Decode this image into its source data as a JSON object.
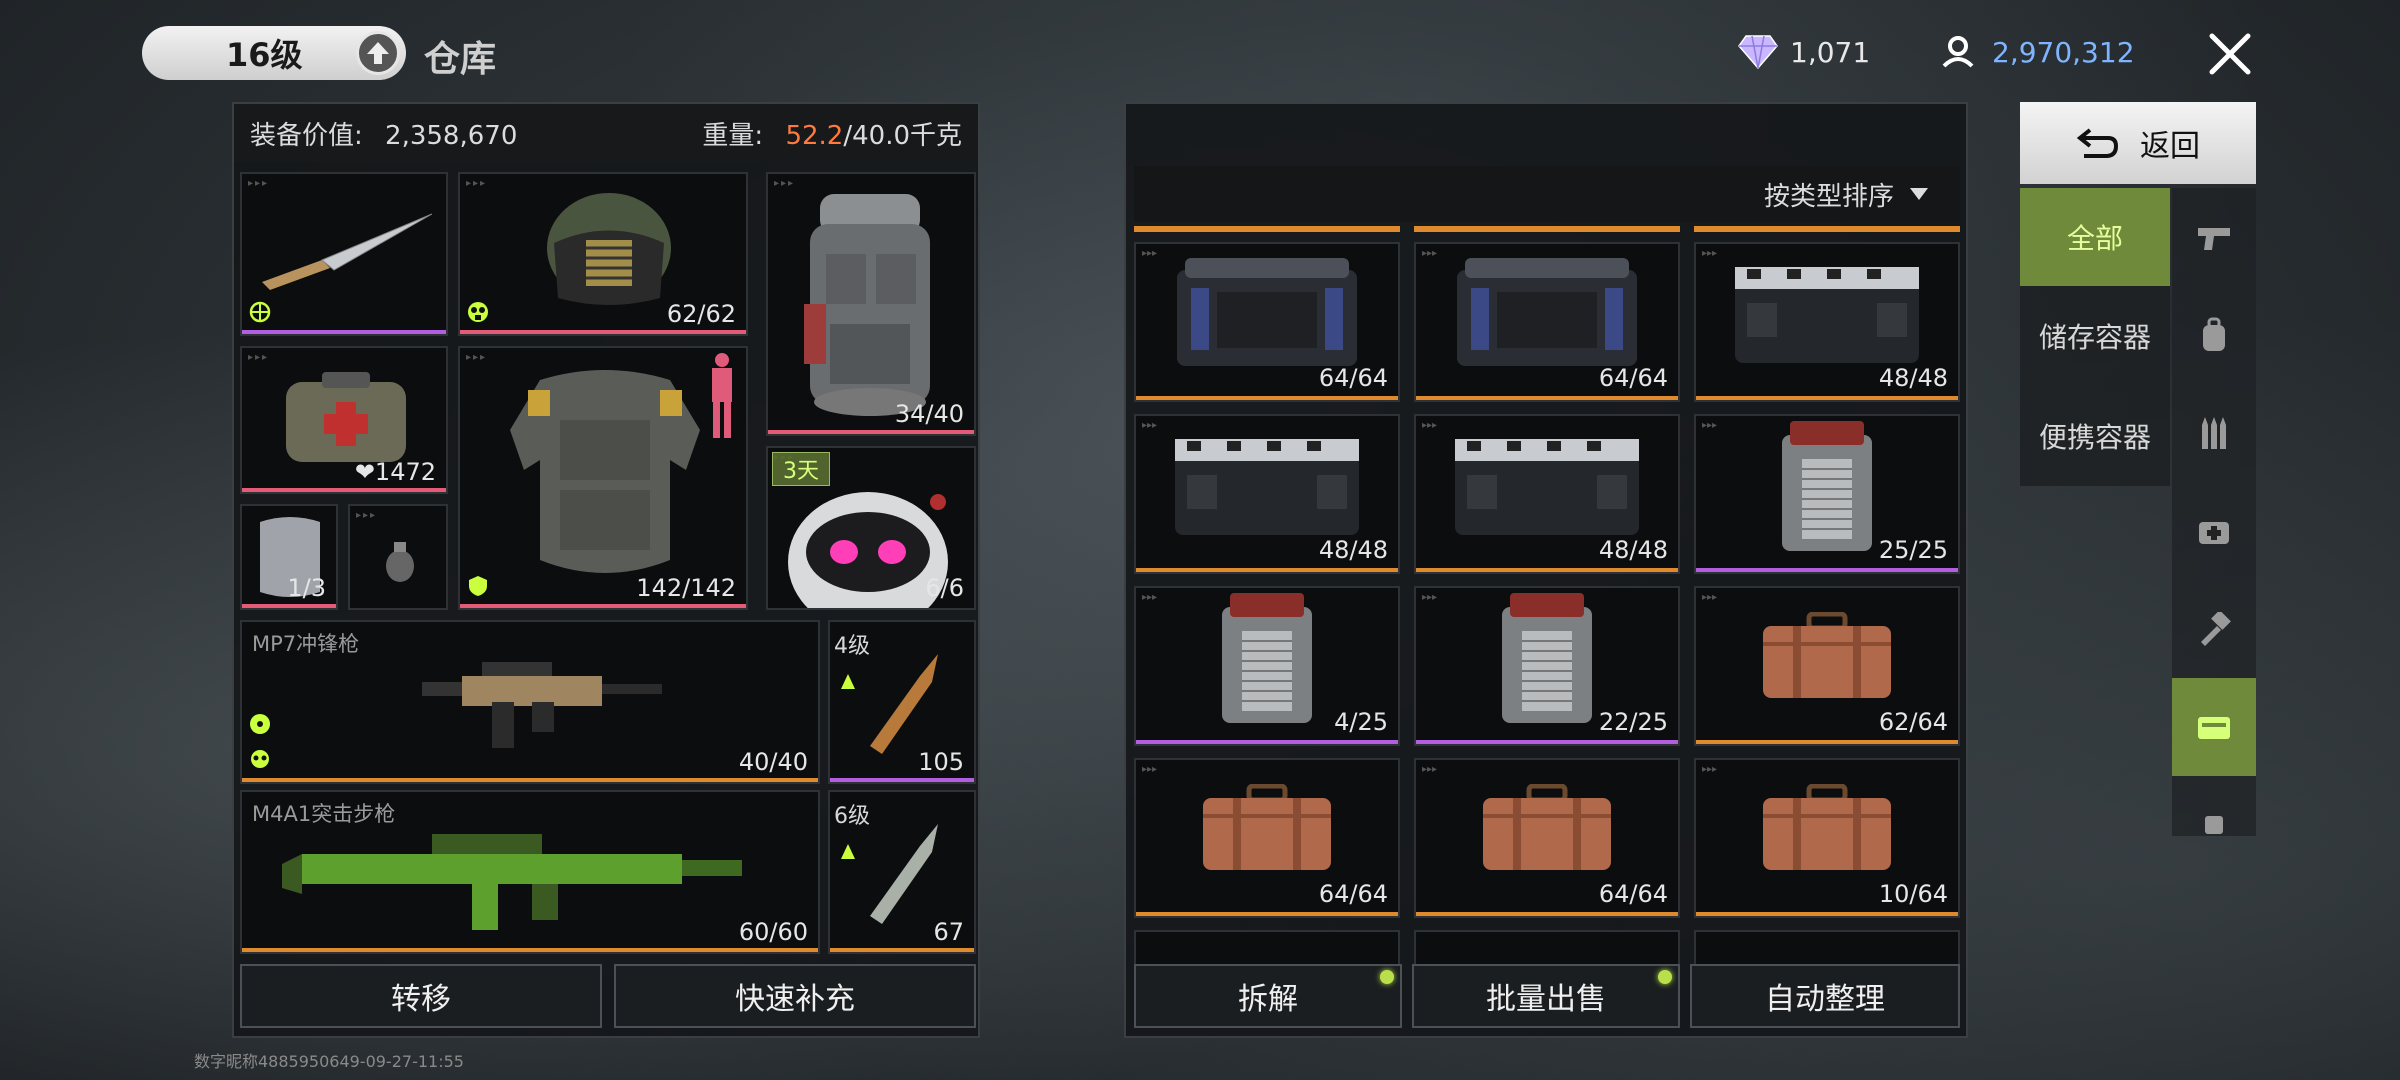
{
  "header": {
    "level": "16级",
    "title": "仓库",
    "gems": "1,071",
    "coins": "2,970,312"
  },
  "left": {
    "equip_value_label": "装备价值:",
    "equip_value": "2,358,670",
    "weight_label": "重量:",
    "weight_current": "52.2",
    "weight_max": "/40.0千克",
    "helmet_count": "62/62",
    "backpack_count": "34/40",
    "medkit_count": "1472",
    "armor_count": "142/142",
    "plate_count": "1/3",
    "pet_days": "3天",
    "pet_count": "6/6",
    "weapon1_name": "MP7冲锋枪",
    "weapon1_count": "40/40",
    "ammo1_level": "4级",
    "ammo1_count": "105",
    "weapon2_name": "M4A1突击步枪",
    "weapon2_count": "60/60",
    "ammo2_level": "6级",
    "ammo2_count": "67",
    "btn_transfer": "转移",
    "btn_refill": "快速补充"
  },
  "right": {
    "sort_label": "按类型排序",
    "items": [
      {
        "type": "crate-blue",
        "count": "64/64",
        "color": "#e08a2e"
      },
      {
        "type": "crate-blue",
        "count": "64/64",
        "color": "#e08a2e"
      },
      {
        "type": "crate-black",
        "count": "48/48",
        "color": "#e08a2e"
      },
      {
        "type": "crate-black",
        "count": "48/48",
        "color": "#e08a2e"
      },
      {
        "type": "crate-black",
        "count": "48/48",
        "color": "#e08a2e"
      },
      {
        "type": "case-grey",
        "count": "25/25",
        "color": "#b35de0"
      },
      {
        "type": "case-grey",
        "count": "4/25",
        "color": "#b35de0"
      },
      {
        "type": "case-grey",
        "count": "22/25",
        "color": "#b35de0"
      },
      {
        "type": "suitcase",
        "count": "62/64",
        "color": "#e08a2e"
      },
      {
        "type": "suitcase",
        "count": "64/64",
        "color": "#e08a2e"
      },
      {
        "type": "suitcase",
        "count": "64/64",
        "color": "#e08a2e"
      },
      {
        "type": "suitcase",
        "count": "10/64",
        "color": "#e08a2e"
      }
    ],
    "btn_dismantle": "拆解",
    "btn_bulk_sell": "批量出售",
    "btn_auto_sort": "自动整理"
  },
  "sidebar": {
    "back": "返回",
    "categories": [
      "全部",
      "储存容器",
      "便携容器"
    ],
    "icons": [
      "pistol-icon",
      "backpack-icon",
      "ammo-icon",
      "medkit-icon",
      "hammer-icon",
      "container-icon"
    ]
  },
  "footer": {
    "id": "数字昵称4885950649-09-27-11:55"
  }
}
